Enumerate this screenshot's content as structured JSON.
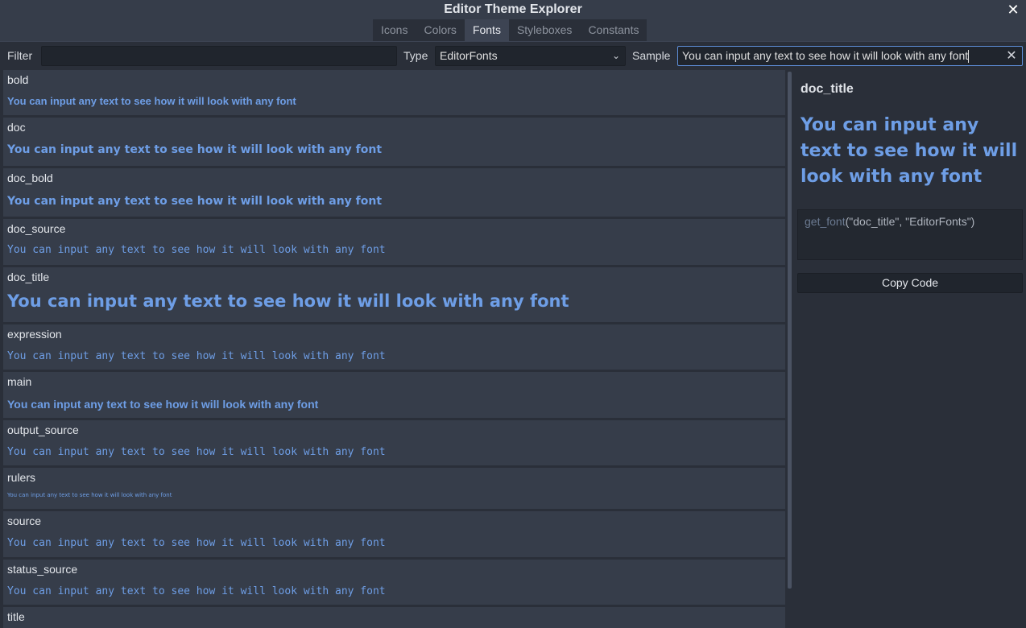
{
  "window": {
    "title": "Editor Theme Explorer",
    "close_glyph": "✕"
  },
  "tabs": [
    {
      "label": "Icons",
      "active": false
    },
    {
      "label": "Colors",
      "active": false
    },
    {
      "label": "Fonts",
      "active": true
    },
    {
      "label": "Styleboxes",
      "active": false
    },
    {
      "label": "Constants",
      "active": false
    }
  ],
  "filter": {
    "label": "Filter",
    "value": ""
  },
  "type": {
    "label": "Type",
    "selected": "EditorFonts"
  },
  "sample": {
    "label": "Sample",
    "value": "You can input any text to see how it will look with any font"
  },
  "fonts": [
    {
      "name": "bold",
      "sample": "You can input any text to see how it will look with any font",
      "style": "bold"
    },
    {
      "name": "doc",
      "sample": "You can input any text to see how it will look with any font",
      "style": "doc"
    },
    {
      "name": "doc_bold",
      "sample": "You can input any text to see how it will look with any font",
      "style": "doc"
    },
    {
      "name": "doc_source",
      "sample": "You can input any text to see how it will look with any font",
      "style": "mono"
    },
    {
      "name": "doc_title",
      "sample": "You can input any text to see how it will look with any font",
      "style": "title"
    },
    {
      "name": "expression",
      "sample": "You can input any text to see how it will look with any font",
      "style": "mono"
    },
    {
      "name": "main",
      "sample": "You can input any text to see how it will look with any font",
      "style": "main"
    },
    {
      "name": "output_source",
      "sample": "You can input any text to see how it will look with any font",
      "style": "mono"
    },
    {
      "name": "rulers",
      "sample": "You can input any text to see how it will look with any font",
      "style": "tiny"
    },
    {
      "name": "source",
      "sample": "You can input any text to see how it will look with any font",
      "style": "mono"
    },
    {
      "name": "status_source",
      "sample": "You can input any text to see how it will look with any font",
      "style": "mono"
    },
    {
      "name": "title",
      "sample": "",
      "style": "main"
    }
  ],
  "preview": {
    "name": "doc_title",
    "sample": "You can input any text to see how it will look with any font",
    "code_fn": "get_font",
    "code_args": "(\"doc_title\", \"EditorFonts\")",
    "copy_label": "Copy Code"
  },
  "colors": {
    "accent": "#6e9ee6",
    "background": "#363d4a",
    "panel": "#2a2f39"
  }
}
